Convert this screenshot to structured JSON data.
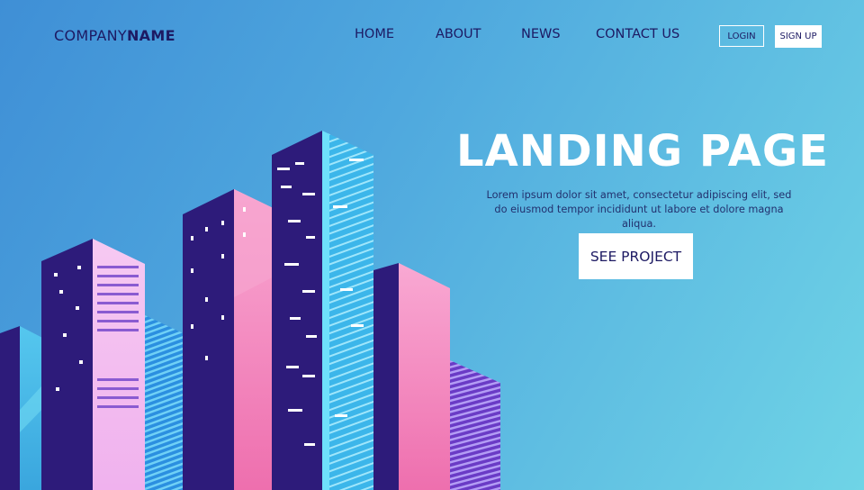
{
  "header": {
    "logo_regular": "COMPANY",
    "logo_bold": "NAME",
    "nav": [
      {
        "label": "HOME"
      },
      {
        "label": "ABOUT"
      },
      {
        "label": "NEWS"
      },
      {
        "label": "CONTACT US"
      }
    ],
    "login_label": "LOGIN",
    "signup_label": "SIGN UP"
  },
  "hero": {
    "title": "LANDING PAGE",
    "description": "Lorem ipsum dolor sit amet, consectetur adipiscing elit, sed do eiusmod tempor incididunt ut labore et dolore magna aliqua.",
    "cta_label": "SEE PROJECT"
  },
  "colors": {
    "primary_text": "#1d1a63",
    "background_start": "#3f8fd6",
    "background_end": "#6fd4e6",
    "building_pink": "#f27fb8",
    "building_purple": "#2d1b7a",
    "building_cyan": "#4fc3ec"
  },
  "illustration": {
    "name": "isometric-city-buildings"
  }
}
